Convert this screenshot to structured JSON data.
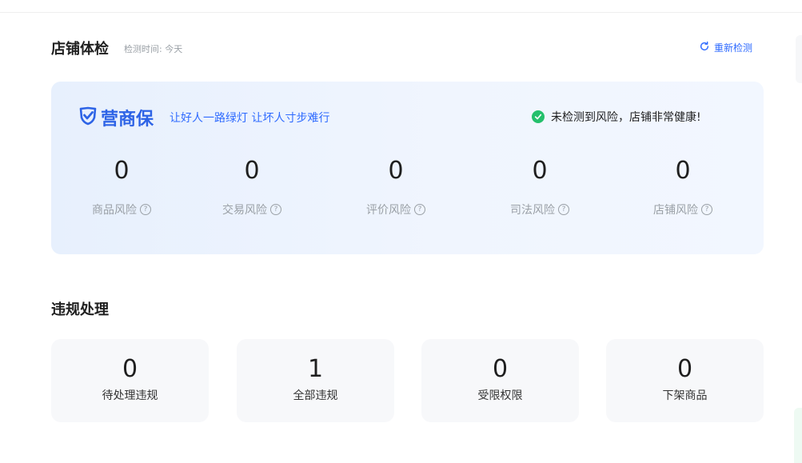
{
  "header": {
    "title": "店铺体检",
    "check_time": "检测时间: 今天",
    "recheck_label": "重新检测"
  },
  "health_card": {
    "brand_name": "营商保",
    "slogan": "让好人一路绿灯 让坏人寸步难行",
    "status_text": "未检测到风险，店铺非常健康!",
    "metrics": [
      {
        "value": "0",
        "label": "商品风险"
      },
      {
        "value": "0",
        "label": "交易风险"
      },
      {
        "value": "0",
        "label": "评价风险"
      },
      {
        "value": "0",
        "label": "司法风险"
      },
      {
        "value": "0",
        "label": "店铺风险"
      }
    ]
  },
  "violations": {
    "title": "违规处理",
    "cards": [
      {
        "value": "0",
        "label": "待处理违规"
      },
      {
        "value": "1",
        "label": "全部违规"
      },
      {
        "value": "0",
        "label": "受限权限"
      },
      {
        "value": "0",
        "label": "下架商品"
      }
    ]
  },
  "colors": {
    "accent": "#2f6bff",
    "brand": "#2d63e6",
    "success": "#24c06c",
    "muted": "#9aa0a6"
  },
  "icons": {
    "recheck": "refresh-icon",
    "brand": "shield-check-icon",
    "status": "check-circle-icon",
    "help": "question-circle-icon"
  }
}
